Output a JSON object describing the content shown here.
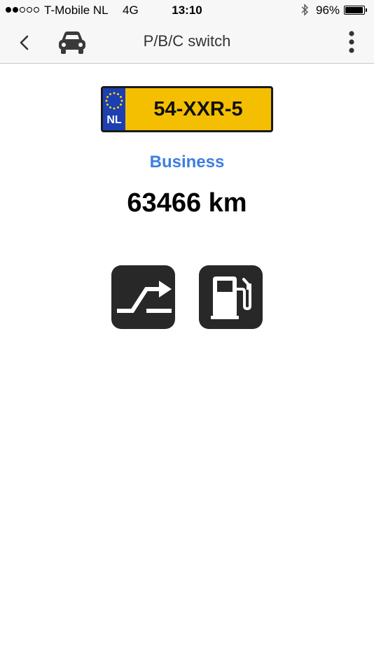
{
  "status_bar": {
    "carrier": "T-Mobile NL",
    "network": "4G",
    "time": "13:10",
    "battery_percent": "96%",
    "battery_level": 0.96,
    "signal_strength": 2,
    "signal_max": 5
  },
  "nav": {
    "title": "P/B/C switch",
    "back_icon": "chevron-left-icon",
    "vehicle_icon": "car-icon",
    "menu_icon": "more-vertical-icon"
  },
  "vehicle": {
    "plate_country": "NL",
    "plate_number": "54-XXR-5",
    "usage_type": "Business",
    "mileage": "63466 km"
  },
  "actions": {
    "switch_icon": "switch-route-icon",
    "fuel_icon": "fuel-pump-icon"
  },
  "colors": {
    "accent": "#3d7fe0",
    "plate_yellow": "#f4bf00",
    "plate_blue": "#1c3fb2",
    "button_dark": "#282828"
  }
}
